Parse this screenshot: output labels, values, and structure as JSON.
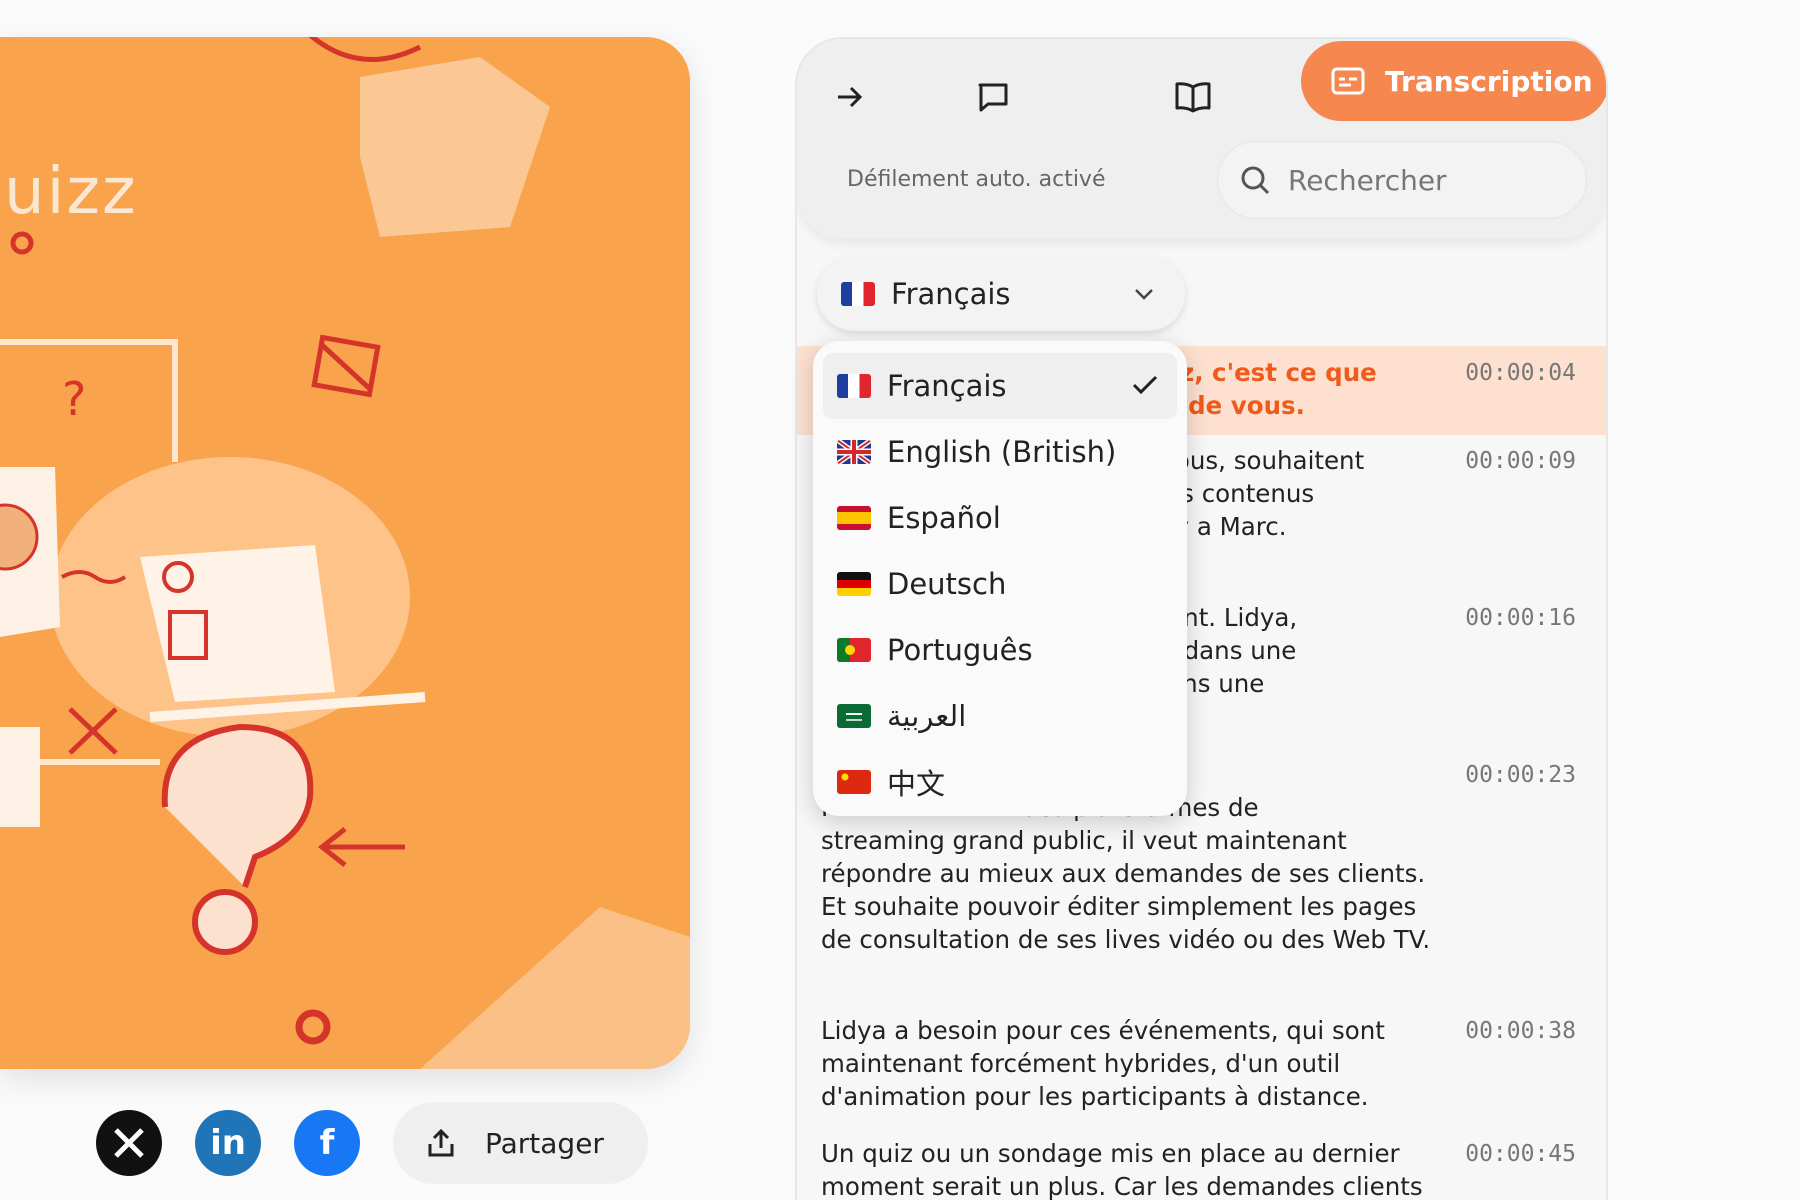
{
  "video": {
    "word": "uizz"
  },
  "share": {
    "button_label": "Partager",
    "linkedin_label": "in",
    "facebook_label": "f"
  },
  "panel": {
    "tabs": {
      "transcription_label": "Transcription"
    },
    "autoscroll_label": "Défilement auto. activé",
    "search_placeholder": "Rechercher",
    "language": {
      "selected": "Français"
    }
  },
  "dropdown": {
    "options": [
      {
        "label": "Français",
        "flag": "fr",
        "selected": true
      },
      {
        "label": "English (British)",
        "flag": "gb",
        "selected": false
      },
      {
        "label": "Español",
        "flag": "es",
        "selected": false
      },
      {
        "label": "Deutsch",
        "flag": "de",
        "selected": false
      },
      {
        "label": "Português",
        "flag": "pt",
        "selected": false
      },
      {
        "label": "العربية",
        "flag": "sa",
        "selected": false
      },
      {
        "label": "中文",
        "flag": "cn",
        "selected": false
      }
    ]
  },
  "transcript": [
    {
      "text": "mfizz, c'est ce que\nirler de vous.",
      "time": "00:00:04",
      "active": true
    },
    {
      "text": "ne vous, souhaitent\nle vos contenus\nd, il y a Marc.",
      "time": "00:00:09",
      "active": false
    },
    {
      "text": "endant. Lidya,\nntiel dans une\nal dans une",
      "time": "00:00:16",
      "active": false
    },
    {
      "text": "ation internationale.\nF                        des plateformes de\nstreaming grand public, il veut maintenant\nrépondre au mieux aux demandes de ses clients.\nEt souhaite pouvoir éditer simplement les pages\nde consultation de ses lives vidéo ou des Web TV.",
      "time": "00:00:23",
      "active": false
    },
    {
      "text": "Lidya a besoin pour ces événements, qui sont\nmaintenant forcément hybrides, d'un outil\nd'animation pour les participants à distance.",
      "time": "00:00:38",
      "active": false
    },
    {
      "text": "Un quiz ou un sondage mis en place au dernier\nmoment serait un plus. Car les demandes clients",
      "time": "00:00:45",
      "active": false
    }
  ],
  "colors": {
    "accent": "#f6884f",
    "active_text": "#f05a1a",
    "video_bg": "#f9a34d"
  }
}
